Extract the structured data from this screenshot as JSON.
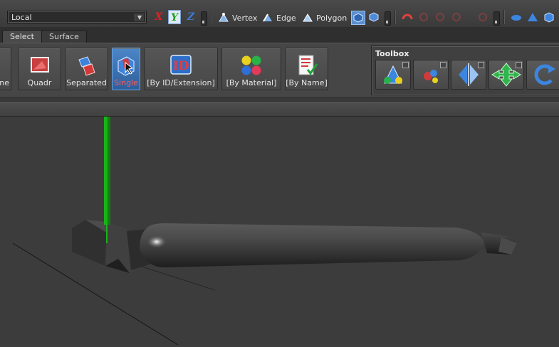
{
  "toolbar": {
    "coordinate_system": "Local",
    "axes": [
      "X",
      "Y",
      "Z"
    ],
    "modes": {
      "vertex_label": "Vertex",
      "edge_label": "Edge",
      "polygon_label": "Polygon"
    }
  },
  "tabs": [
    {
      "label": "Select",
      "active": true
    },
    {
      "label": "Surface",
      "active": false
    }
  ],
  "ribbon": {
    "buttons": [
      {
        "label": "ne",
        "icon": "globe-icon"
      },
      {
        "label": "Quadr",
        "icon": "quad-select-icon"
      },
      {
        "label": "Separated",
        "icon": "separated-select-icon"
      },
      {
        "label": "Single",
        "icon": "single-select-icon",
        "selected": true
      },
      {
        "label": "[By ID/Extension]",
        "icon": "id-icon"
      },
      {
        "label": "[By Material]",
        "icon": "material-balls-icon"
      },
      {
        "label": "[By Name]",
        "icon": "list-check-icon"
      }
    ]
  },
  "toolbox": {
    "title": "Toolbox",
    "tools": [
      "create-tool-icon",
      "scatter-tool-icon",
      "mirror-tool-icon",
      "move-tool-icon",
      "rotate-tool-icon"
    ]
  },
  "colors": {
    "selected_blue": "#3a72b8",
    "axis_x": "#d02020",
    "axis_y": "#22a022",
    "axis_z": "#2f6fd0",
    "viewport_bg": "#3c3c3c",
    "gizmo_green": "#19b319"
  }
}
